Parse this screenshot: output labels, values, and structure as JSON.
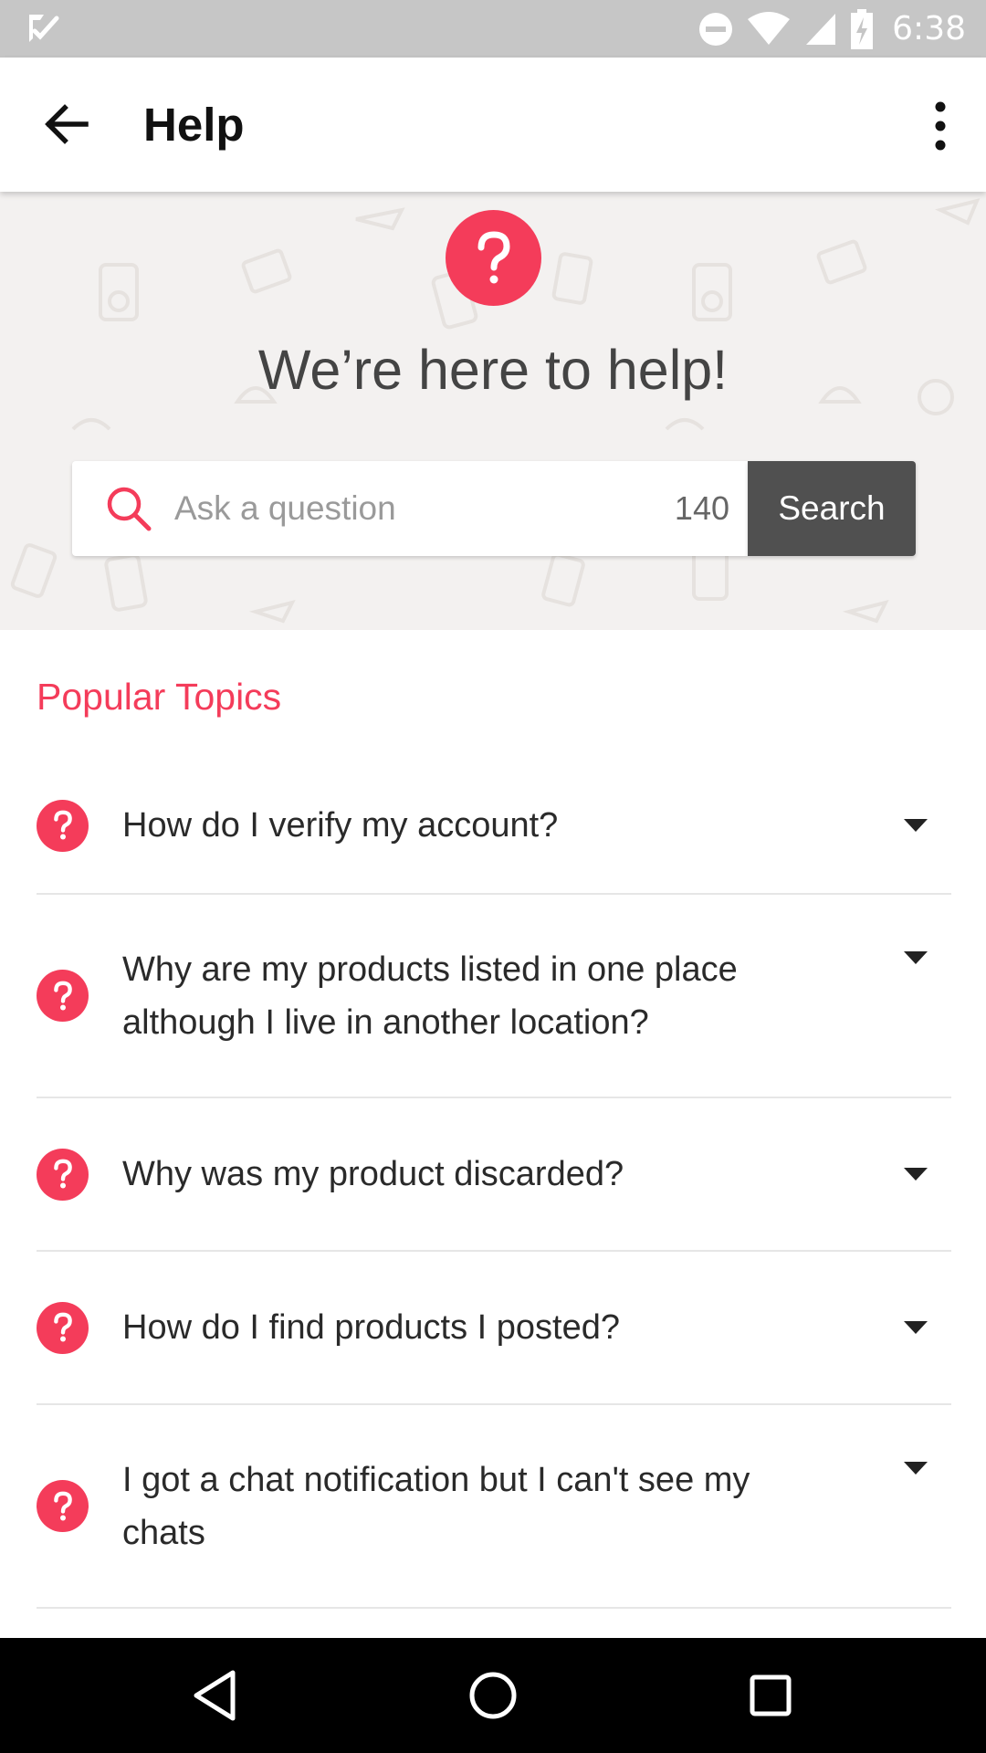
{
  "status_bar": {
    "time": "6:38",
    "icons": [
      "notification-check-icon",
      "do-not-disturb-icon",
      "wifi-icon",
      "signal-icon",
      "battery-charging-icon"
    ]
  },
  "app_bar": {
    "title": "Help",
    "back_icon": "arrow-back-icon",
    "menu_icon": "more-vert-icon"
  },
  "hero": {
    "headline": "We’re here to help!",
    "badge_icon": "question-mark-icon"
  },
  "search": {
    "placeholder": "Ask a question",
    "value": "",
    "char_count": "140",
    "button_label": "Search"
  },
  "topics": {
    "title": "Popular Topics",
    "items": [
      {
        "label": "How do I verify my account?"
      },
      {
        "label": "Why are my products listed in one place although I live in another location?"
      },
      {
        "label": "Why was my product discarded?"
      },
      {
        "label": "How do I find products I posted?"
      },
      {
        "label": "I got a chat notification but I can't see my chats"
      }
    ]
  },
  "nav_bar": {
    "icons": [
      "nav-back-icon",
      "nav-home-icon",
      "nav-recents-icon"
    ]
  },
  "colors": {
    "accent": "#f43c5a",
    "search_button": "#505050",
    "hero_background": "#f3f1f0",
    "status_bar": "#c6c6c6"
  }
}
